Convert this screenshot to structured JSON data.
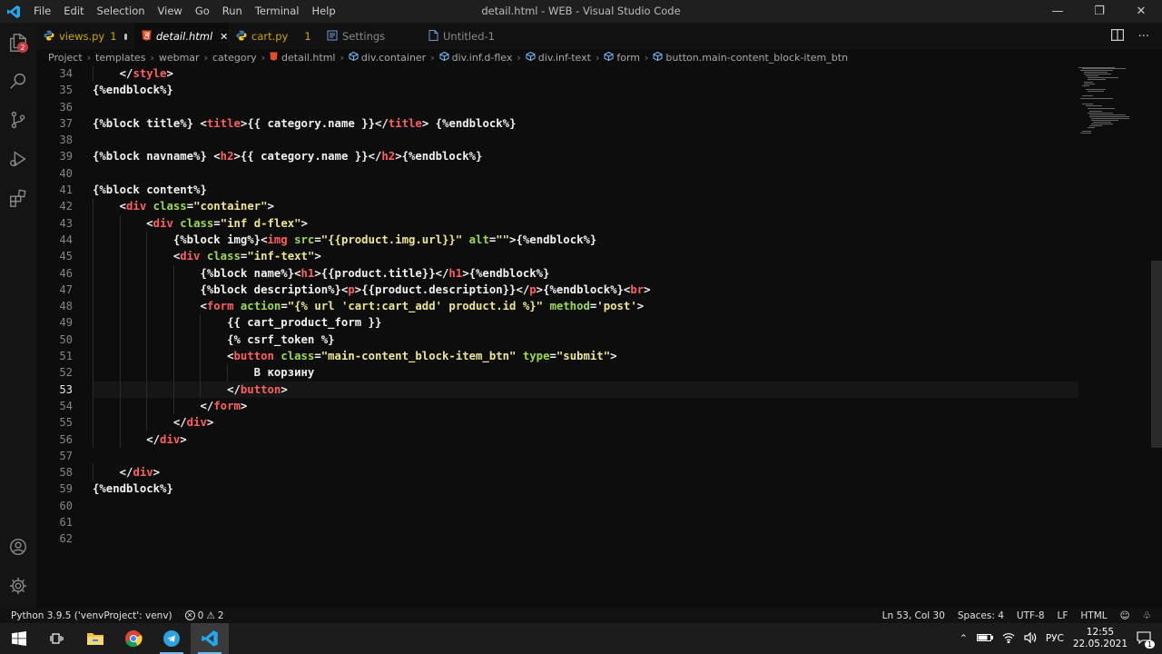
{
  "window": {
    "title": "detail.html - WEB - Visual Studio Code"
  },
  "menu": [
    "File",
    "Edit",
    "Selection",
    "View",
    "Go",
    "Run",
    "Terminal",
    "Help"
  ],
  "activity": {
    "explorer_badge": "2"
  },
  "tabs": [
    {
      "label": "views.py",
      "marker": "1",
      "state": "modified",
      "icon": "python-icon"
    },
    {
      "label": "detail.html",
      "state": "active-close",
      "icon": "html-icon"
    },
    {
      "label": "cart.py",
      "marker": "1",
      "state": "modified",
      "icon": "python-icon"
    },
    {
      "label": "Settings",
      "icon": "settings-file-icon"
    },
    {
      "label": "Untitled-1",
      "icon": "file-icon"
    }
  ],
  "breadcrumb": [
    "Project",
    "templates",
    "webmar",
    "category",
    "detail.html",
    "div.container",
    "div.inf.d-flex",
    "div.inf-text",
    "form",
    "button.main-content_block-item_btn"
  ],
  "editor": {
    "current_line": "53",
    "lines": [
      {
        "n": "34",
        "text": "    </style>"
      },
      {
        "n": "35",
        "text": "{%endblock%}"
      },
      {
        "n": "36",
        "text": ""
      },
      {
        "n": "37",
        "text": "{%block title%} <title>{{ category.name }}</title> {%endblock%}"
      },
      {
        "n": "38",
        "text": ""
      },
      {
        "n": "39",
        "text": "{%block navname%} <h2>{{ category.name }}</h2>{%endblock%}"
      },
      {
        "n": "40",
        "text": ""
      },
      {
        "n": "41",
        "text": "{%block content%}"
      },
      {
        "n": "42",
        "text": "    <div class=\"container\">"
      },
      {
        "n": "43",
        "text": "        <div class=\"inf d-flex\">"
      },
      {
        "n": "44",
        "text": "            {%block img%}<img src=\"{{product.img.url}}\" alt=\"\">{%endblock%}"
      },
      {
        "n": "45",
        "text": "            <div class=\"inf-text\">"
      },
      {
        "n": "46",
        "text": "                {%block name%}<h1>{{product.title}}</h1>{%endblock%}"
      },
      {
        "n": "47",
        "text": "                {%block description%}<p>{{product.description}}</p>{%endblock%}<br>"
      },
      {
        "n": "48",
        "text": "                <form action=\"{% url 'cart:cart_add' product.id %}\" method='post'>"
      },
      {
        "n": "49",
        "text": "                    {{ cart_product_form }}"
      },
      {
        "n": "50",
        "text": "                    {% csrf_token %}"
      },
      {
        "n": "51",
        "text": "                    <button class=\"main-content_block-item_btn\" type=\"submit\">"
      },
      {
        "n": "52",
        "text": "                        В корзину"
      },
      {
        "n": "53",
        "text": "                    </button>"
      },
      {
        "n": "54",
        "text": "                </form>"
      },
      {
        "n": "55",
        "text": "            </div>"
      },
      {
        "n": "56",
        "text": "        </div>"
      },
      {
        "n": "57",
        "text": ""
      },
      {
        "n": "58",
        "text": "    </div>"
      },
      {
        "n": "59",
        "text": "{%endblock%}"
      },
      {
        "n": "60",
        "text": ""
      },
      {
        "n": "61",
        "text": ""
      },
      {
        "n": "62",
        "text": ""
      }
    ]
  },
  "status": {
    "interpreter": "Python 3.9.5 ('venvProject': venv)",
    "errors": "0",
    "warnings": "2",
    "position": "Ln 53, Col 30",
    "spaces": "Spaces: 4",
    "encoding": "UTF-8",
    "eol": "LF",
    "language": "HTML"
  },
  "taskbar": {
    "lang": "РУС",
    "time": "12:55",
    "date": "22.05.2021",
    "notifications": "1"
  },
  "colors": {
    "tag": "#ff5f5f",
    "attr": "#9bdb4d",
    "string": "#f0e68c",
    "text": "#f2f2f2",
    "modified": "#cca700"
  }
}
